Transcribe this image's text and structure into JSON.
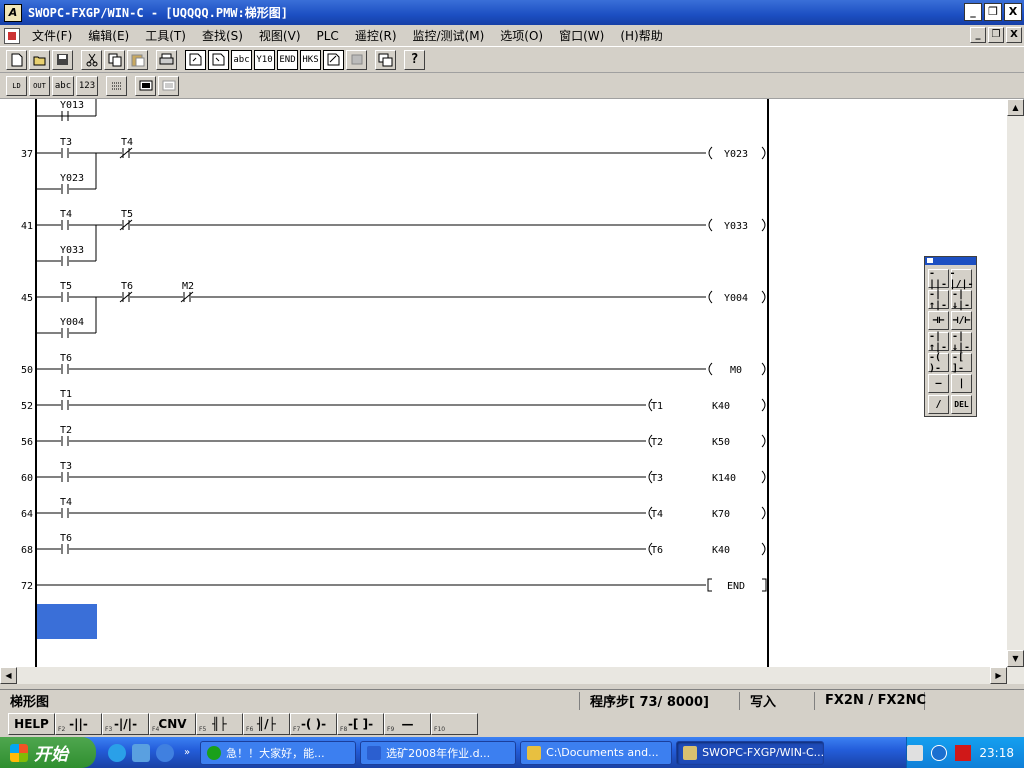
{
  "window": {
    "title": "SWOPC-FXGP/WIN-C - [UQQQQ.PMW:梯形图]",
    "controls": [
      "_",
      "❐",
      "X"
    ]
  },
  "menu": {
    "items": [
      "文件(F)",
      "编辑(E)",
      "工具(T)",
      "查找(S)",
      "视图(V)",
      "PLC",
      "遥控(R)",
      "监控/测试(M)",
      "选项(O)",
      "窗口(W)",
      "(H)帮助"
    ],
    "mdi_controls": [
      "_",
      "❐",
      "X"
    ]
  },
  "toolbar1": {
    "buttons": [
      "new-file",
      "open-file",
      "save-file",
      "cut",
      "copy",
      "paste",
      "print",
      "tool-a",
      "tool-b",
      "tool-c",
      "tool-d",
      "tool-e",
      "tool-f",
      "tool-g",
      "tool-h",
      "tool-i",
      "help"
    ],
    "labels": {
      "tool-c": "abc",
      "tool-d": "Y10",
      "tool-e": "END",
      "tool-f": "HKS"
    }
  },
  "toolbar2": {
    "labels": [
      "LD",
      "OUT",
      "abc",
      "123",
      "",
      "",
      ""
    ]
  },
  "ladder": {
    "top_partial_contact": "Y013",
    "rungs": [
      {
        "step": "37",
        "contacts": [
          {
            "label": "T3",
            "type": "NO"
          },
          {
            "label": "T4",
            "type": "NC"
          }
        ],
        "parallel": [
          {
            "label": "Y023",
            "type": "NO"
          }
        ],
        "coil": {
          "type": "output",
          "label": "Y023"
        }
      },
      {
        "step": "41",
        "contacts": [
          {
            "label": "T4",
            "type": "NO"
          },
          {
            "label": "T5",
            "type": "NC"
          }
        ],
        "parallel": [
          {
            "label": "Y033",
            "type": "NO"
          }
        ],
        "coil": {
          "type": "output",
          "label": "Y033"
        }
      },
      {
        "step": "45",
        "contacts": [
          {
            "label": "T5",
            "type": "NO"
          },
          {
            "label": "T6",
            "type": "NC"
          },
          {
            "label": "M2",
            "type": "NC"
          }
        ],
        "parallel": [
          {
            "label": "Y004",
            "type": "NO"
          }
        ],
        "coil": {
          "type": "output",
          "label": "Y004"
        }
      },
      {
        "step": "50",
        "contacts": [
          {
            "label": "T6",
            "type": "NO"
          }
        ],
        "parallel": [],
        "coil": {
          "type": "output",
          "label": "M0"
        }
      },
      {
        "step": "52",
        "contacts": [
          {
            "label": "T1",
            "type": "NO"
          }
        ],
        "parallel": [],
        "coil": {
          "type": "timer",
          "label": "T1",
          "value": "K40"
        }
      },
      {
        "step": "56",
        "contacts": [
          {
            "label": "T2",
            "type": "NO"
          }
        ],
        "parallel": [],
        "coil": {
          "type": "timer",
          "label": "T2",
          "value": "K50"
        }
      },
      {
        "step": "60",
        "contacts": [
          {
            "label": "T3",
            "type": "NO"
          }
        ],
        "parallel": [],
        "coil": {
          "type": "timer",
          "label": "T3",
          "value": "K140"
        }
      },
      {
        "step": "64",
        "contacts": [
          {
            "label": "T4",
            "type": "NO"
          }
        ],
        "parallel": [],
        "coil": {
          "type": "timer",
          "label": "T4",
          "value": "K70"
        }
      },
      {
        "step": "68",
        "contacts": [
          {
            "label": "T6",
            "type": "NO"
          }
        ],
        "parallel": [],
        "coil": {
          "type": "timer",
          "label": "T6",
          "value": "K40"
        }
      },
      {
        "step": "72",
        "contacts": [],
        "parallel": [],
        "coil": {
          "type": "end",
          "label": "END"
        }
      }
    ],
    "cursor_color": "#3a6fd8"
  },
  "palette": {
    "tools": [
      "-||-",
      "-|/|-",
      "-|↑|-",
      "-|↓|-",
      "⊣⊢",
      "⊣/⊢",
      "-|↑|-",
      "-|↓|-",
      "-( )-",
      "-[ ]-",
      "—",
      "|",
      "/",
      "DEL"
    ]
  },
  "status": {
    "mode": "梯形图",
    "program_steps": "程序步[  73/ 8000]",
    "write": "写入",
    "plc_model": "FX2N / FX2NC"
  },
  "fkeys": [
    {
      "n": "",
      "label": "HELP"
    },
    {
      "n": "F2",
      "label": "-||-"
    },
    {
      "n": "F3",
      "label": "-|/|-"
    },
    {
      "n": "F4",
      "label": "CNV"
    },
    {
      "n": "F5",
      "label": "╢├"
    },
    {
      "n": "F6",
      "label": "╢/├"
    },
    {
      "n": "F7",
      "label": "-( )-"
    },
    {
      "n": "F8",
      "label": "-[ ]-"
    },
    {
      "n": "F9",
      "label": "—"
    },
    {
      "n": "F10",
      "label": ""
    }
  ],
  "taskbar": {
    "start_label": "开始",
    "quick_launch_count": 3,
    "tasks": [
      {
        "label": "急！！大家好，能...",
        "icon_color": "#1aa01a",
        "active": false
      },
      {
        "label": "选矿2008年作业.d...",
        "icon_color": "#2b5fd0",
        "active": false
      },
      {
        "label": "C:\\Documents and...",
        "icon_color": "#e8c040",
        "active": false
      },
      {
        "label": "SWOPC-FXGP/WIN-C...",
        "icon_color": "#d8c070",
        "active": true
      }
    ],
    "clock": "23:18"
  },
  "colors": {
    "titlebar": "#1c4fc2",
    "taskbar": "#245edb",
    "start_green": "#2f8f2f",
    "ladder_line": "#000000",
    "canvas": "#ffffff"
  }
}
